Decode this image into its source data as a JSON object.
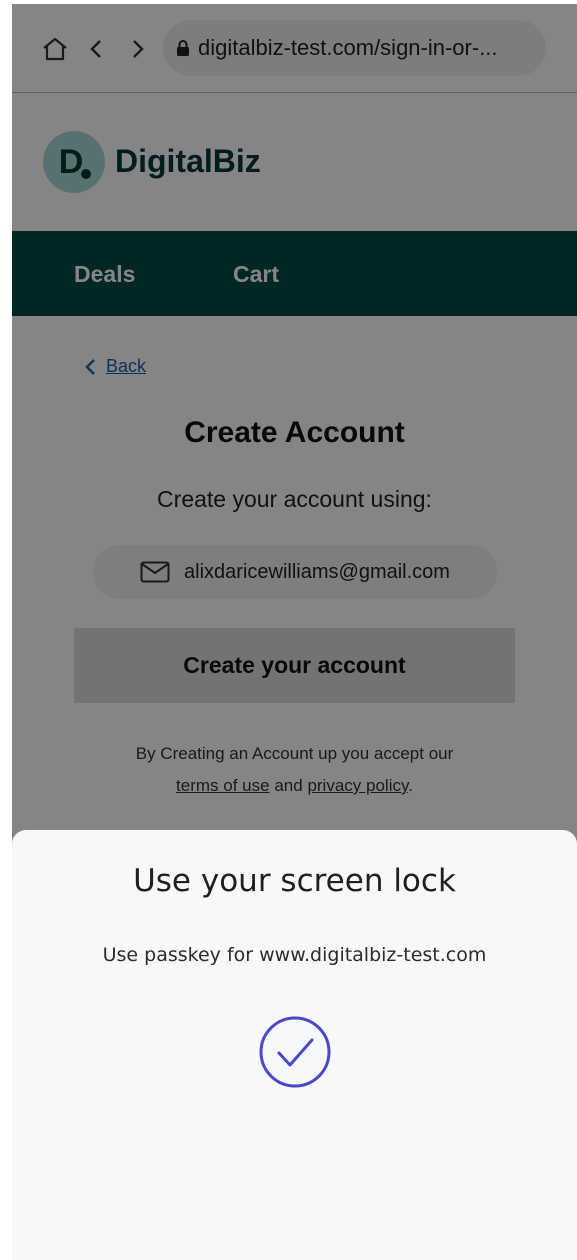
{
  "browser": {
    "url": "digitalbiz-test.com/sign-in-or-..."
  },
  "site": {
    "logo_letter": "D",
    "logo_text": "DigitalBiz",
    "nav": [
      "Deals",
      "Cart"
    ]
  },
  "main": {
    "back_label": "Back",
    "title": "Create Account",
    "subtitle": "Create your account using:",
    "email": "alixdaricewilliams@gmail.com",
    "create_button": "Create your account",
    "legal": {
      "prefix": "By Creating an Account up you accept our",
      "terms": "terms of use",
      "and": "and",
      "privacy": "privacy policy",
      "suffix": "."
    }
  },
  "sheet": {
    "title": "Use your screen lock",
    "subtitle": "Use passkey for www.digitalbiz-test.com",
    "icon": "checkmark-circle-icon"
  },
  "colors": {
    "brand": "#004a4a",
    "logo_bg": "#a7d9d9",
    "link": "#1d5fb3",
    "check": "#4a47c8"
  }
}
